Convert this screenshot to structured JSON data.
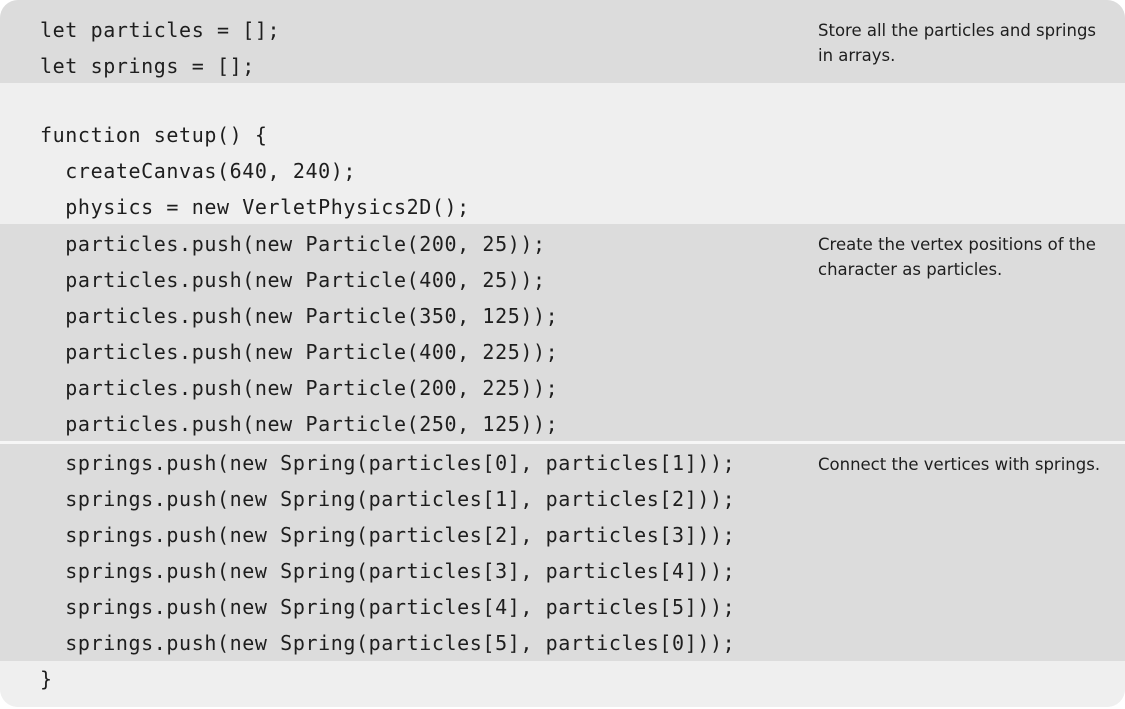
{
  "code": {
    "lines": [
      "let particles = [];",
      "let springs = [];",
      "",
      "function setup() {",
      "  createCanvas(640, 240);",
      "  physics = new VerletPhysics2D();",
      "  particles.push(new Particle(200, 25));",
      "  particles.push(new Particle(400, 25));",
      "  particles.push(new Particle(350, 125));",
      "  particles.push(new Particle(400, 225));",
      "  particles.push(new Particle(200, 225));",
      "  particles.push(new Particle(250, 125));",
      "  springs.push(new Spring(particles[0], particles[1]));",
      "  springs.push(new Spring(particles[1], particles[2]));",
      "  springs.push(new Spring(particles[2], particles[3]));",
      "  springs.push(new Spring(particles[3], particles[4]));",
      "  springs.push(new Spring(particles[4], particles[5]));",
      "  springs.push(new Spring(particles[5], particles[0]));",
      "}"
    ]
  },
  "annotations": {
    "store_arrays": "Store all the particles and springs in arrays.",
    "vertex_positions": "Create the vertex positions of the character as particles.",
    "connect_springs": "Connect the vertices with springs."
  }
}
